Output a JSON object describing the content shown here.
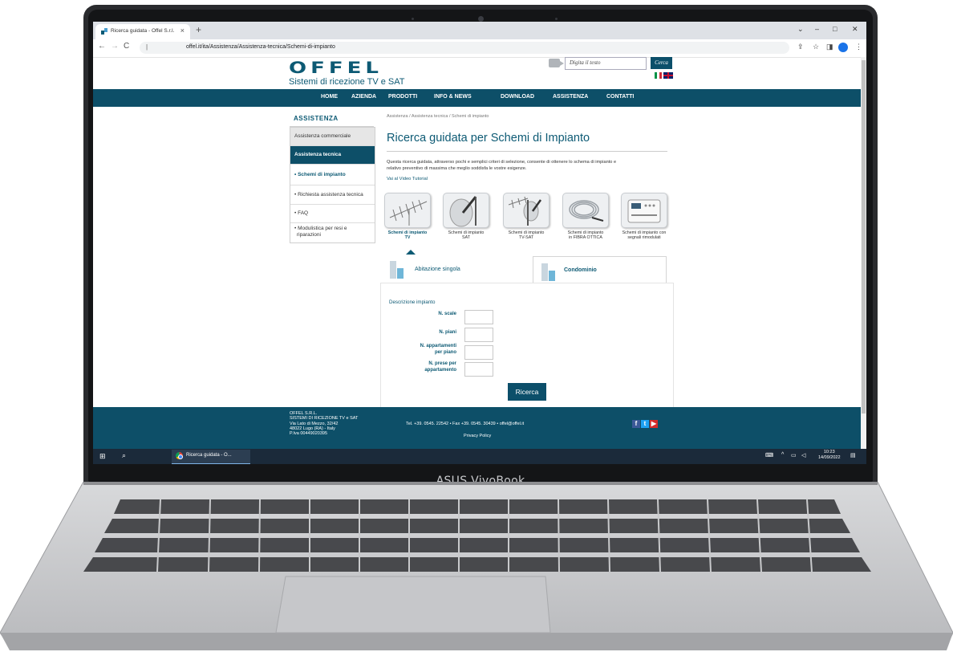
{
  "browser": {
    "tab_title": "Ricerca guidata - Offel S.r.l.",
    "tab_close": "×",
    "new_tab": "+",
    "url": "offel.it/ita/Assistenza/Assistenza-tecnica/Schemi-di-impianto",
    "win_min": "–",
    "win_max": "□",
    "win_close": "✕",
    "win_dropdown": "⌄"
  },
  "site": {
    "logo_text": "OFFEL",
    "logo_subtitle": "Sistemi di ricezione TV e SAT",
    "search_placeholder": "Digita il testo",
    "search_button": "Cerca"
  },
  "nav": [
    "HOME",
    "AZIENDA",
    "PRODOTTI",
    "INFO & NEWS",
    "DOWNLOAD",
    "ASSISTENZA",
    "CONTATTI"
  ],
  "sidebar": {
    "title": "ASSISTENZA",
    "items": [
      {
        "label": "Assistenza commerciale"
      },
      {
        "label": "Assistenza tecnica"
      },
      {
        "label": "• Schemi di impianto"
      },
      {
        "label": "• Richiesta assistenza tecnica"
      },
      {
        "label": "• FAQ"
      },
      {
        "label": "• Modulistica per resi e"
      },
      {
        "label": "riparazioni"
      }
    ]
  },
  "content": {
    "breadcrumb": "Assistenza / Assistenza tecnica / Schemi di impianto",
    "title": "Ricerca guidata per Schemi di Impianto",
    "intro_line1": "Questa ricerca guidata, attraverso pochi e semplici criteri di selezione, consente di ottenere lo schema di impianto e",
    "intro_line2": "relativo preventivo di massima che meglio soddisfa le vostre esigenze.",
    "video_link": "Vai al Video Tutorial",
    "categories": [
      {
        "l1": "Schemi di impianto",
        "l2": "TV"
      },
      {
        "l1": "Schemi di impianto",
        "l2": "SAT"
      },
      {
        "l1": "Schemi di impianto",
        "l2": "TV-SAT"
      },
      {
        "l1": "Schemi di impianto",
        "l2": "in FIBRA OTTICA"
      },
      {
        "l1": "Schemi di impianto con",
        "l2": "segnali rimodulati"
      }
    ],
    "tabs": {
      "single": "Abitazione singola",
      "condo": "Condominio"
    },
    "form": {
      "legend": "Descrizione impianto",
      "scale": "N. scale",
      "piani": "N. piani",
      "app1": "N. appartamenti",
      "app2": "per piano",
      "prese1": "N. prese per",
      "prese2": "appartamento",
      "submit": "Ricerca"
    }
  },
  "footer": {
    "company": "OFFEL S.R.L.",
    "tagline": "SISTEMI DI RICEZIONE TV e SAT",
    "street": "Via Lato di Mezzo, 32/42",
    "city": "48022 Lugo (RA) - Italy",
    "vat": "P.Iva 00449020395",
    "contacts": "Tel. +39. 0545. 22542  •  Fax +39. 0545. 30439  •  offel@offel.it",
    "privacy": "Privacy Policy",
    "social_f": "f",
    "social_t": "t"
  },
  "taskbar": {
    "app_label": "Ricerca guidata - O...",
    "time": "10:23",
    "date": "14/09/2022"
  },
  "laptop": {
    "brand": "ASUS VivoBook"
  },
  "colors": {
    "brand_blue": "#0d5a74",
    "nav_bg": "#0d4f68",
    "accent": "#0c4f6a"
  }
}
